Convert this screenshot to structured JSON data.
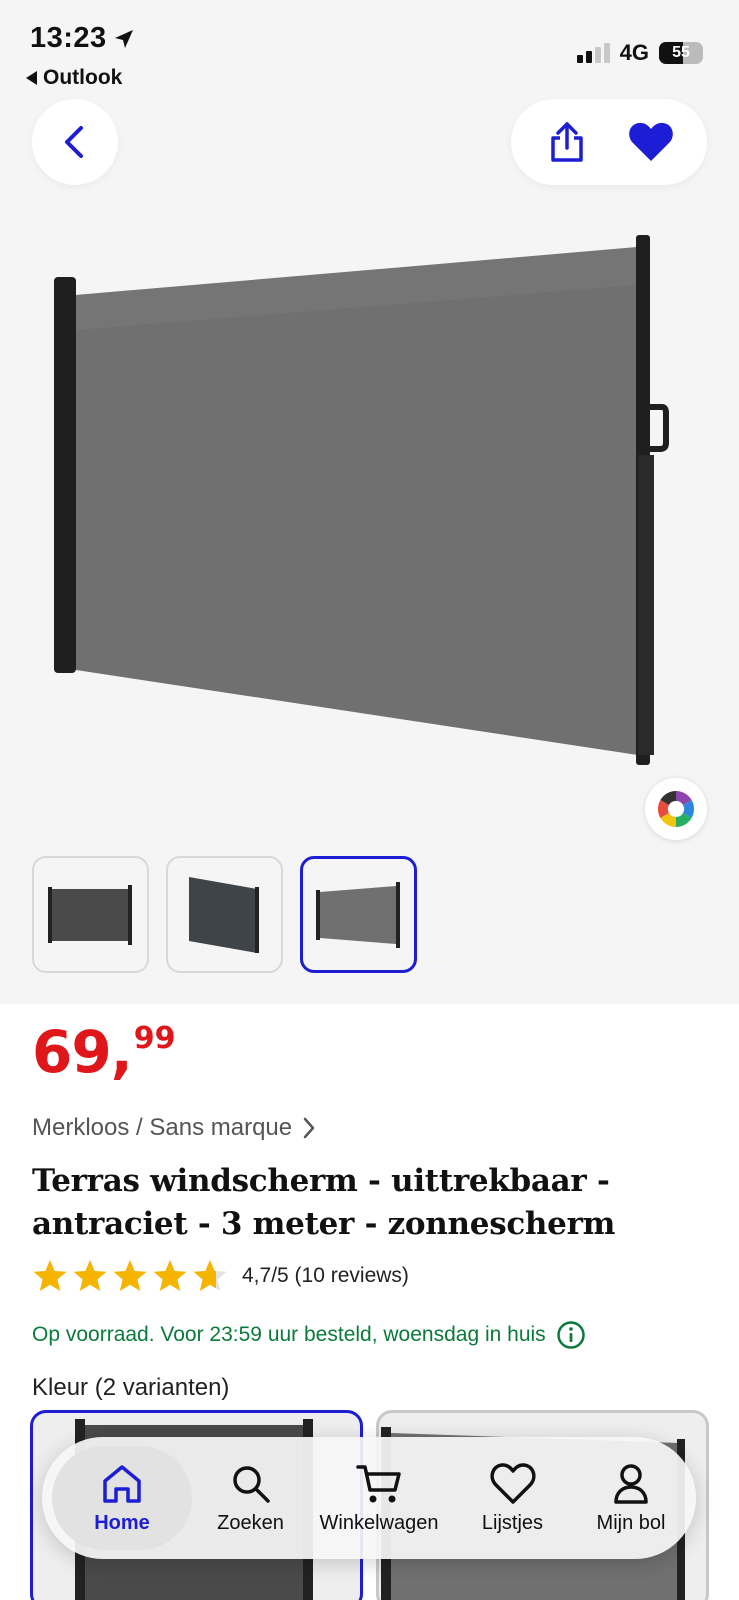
{
  "status_bar": {
    "time": "13:23",
    "back_app": "Outlook",
    "network": "4G",
    "battery": "55"
  },
  "gallery": {
    "thumbnail_count": 3,
    "active_thumbnail": 3,
    "favorite_active": true
  },
  "product": {
    "price_whole": "69,",
    "price_cents": "99",
    "brand": "Merkloos / Sans marque",
    "title": "Terras windscherm - uittrekbaar - antraciet - 3 meter - zonnescherm",
    "rating_value": 4.7,
    "rating_text": "4,7/5 (10 reviews)",
    "delivery": "Op voorraad. Voor 23:59 uur besteld, woensdag in huis",
    "variants_label": "Kleur (2 varianten)"
  },
  "bottom_nav": {
    "items": [
      {
        "label": "Home",
        "icon": "home-icon",
        "active": true
      },
      {
        "label": "Zoeken",
        "icon": "search-icon",
        "active": false
      },
      {
        "label": "Winkelwagen",
        "icon": "cart-icon",
        "active": false
      },
      {
        "label": "Lijstjes",
        "icon": "heart-icon",
        "active": false
      },
      {
        "label": "Mijn bol",
        "icon": "user-icon",
        "active": false
      }
    ]
  },
  "colors": {
    "accent": "#1d1dd6",
    "price": "#e0171a",
    "stock": "#0b7a3a",
    "star": "#f5b400"
  }
}
